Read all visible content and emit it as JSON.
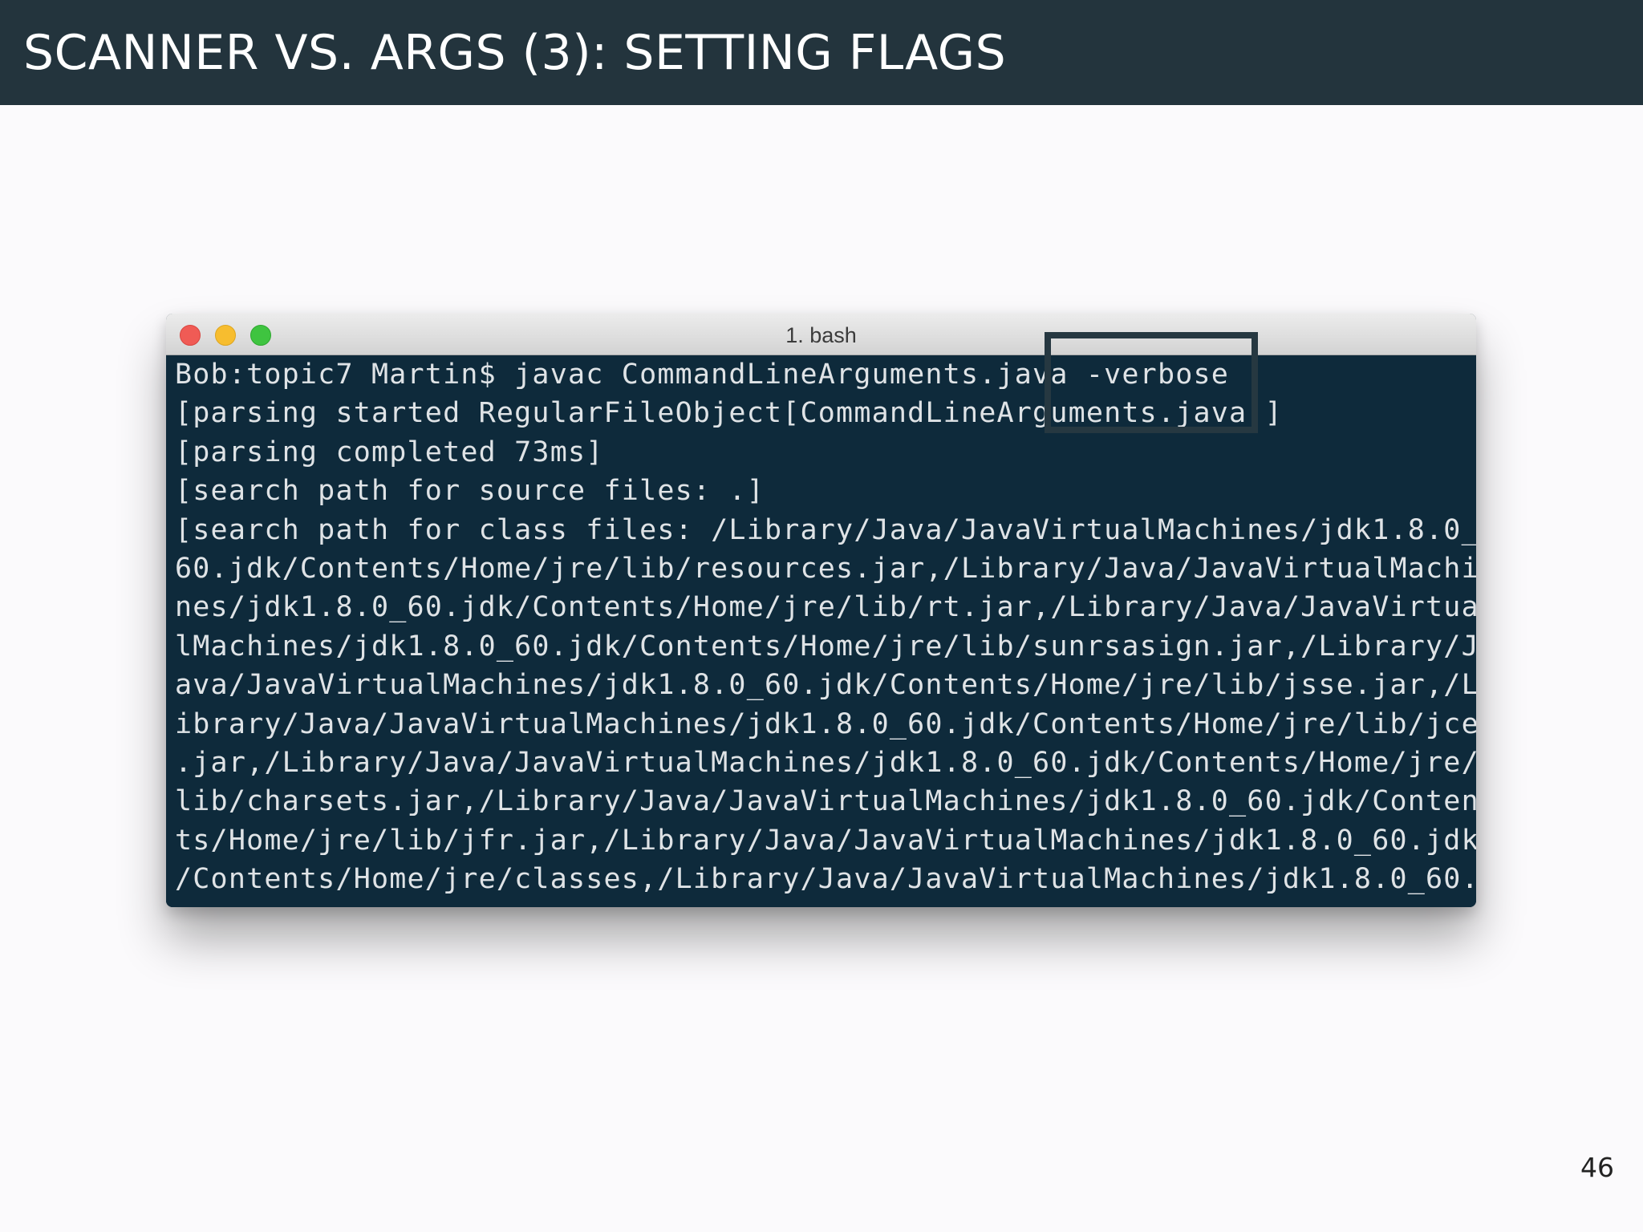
{
  "slide": {
    "title": "SCANNER VS. ARGS (3): SETTING FLAGS",
    "page_number": "46"
  },
  "terminal": {
    "window_title": "1. bash",
    "lines": [
      "Bob:topic7 Martin$ javac CommandLineArguments.java -verbose",
      "[parsing started RegularFileObject[CommandLineArguments.java]]",
      "[parsing completed 73ms]",
      "[search path for source files: .]",
      "[search path for class files: /Library/Java/JavaVirtualMachines/jdk1.8.0_",
      "60.jdk/Contents/Home/jre/lib/resources.jar,/Library/Java/JavaVirtualMachi",
      "nes/jdk1.8.0_60.jdk/Contents/Home/jre/lib/rt.jar,/Library/Java/JavaVirtua",
      "lMachines/jdk1.8.0_60.jdk/Contents/Home/jre/lib/sunrsasign.jar,/Library/J",
      "ava/JavaVirtualMachines/jdk1.8.0_60.jdk/Contents/Home/jre/lib/jsse.jar,/L",
      "ibrary/Java/JavaVirtualMachines/jdk1.8.0_60.jdk/Contents/Home/jre/lib/jce",
      ".jar,/Library/Java/JavaVirtualMachines/jdk1.8.0_60.jdk/Contents/Home/jre/",
      "lib/charsets.jar,/Library/Java/JavaVirtualMachines/jdk1.8.0_60.jdk/Conten",
      "ts/Home/jre/lib/jfr.jar,/Library/Java/JavaVirtualMachines/jdk1.8.0_60.jdk",
      "/Contents/Home/jre/classes,/Library/Java/JavaVirtualMachines/jdk1.8.0_60."
    ]
  },
  "colors": {
    "header_background": "#23343d",
    "slide_background": "#fbfafc",
    "terminal_background": "#0e2a3b",
    "terminal_text": "#dfe3e6",
    "highlight_border": "#263841",
    "close_button": "#f05b55",
    "minimize_button": "#f7bd2f",
    "zoom_button": "#3fc440"
  },
  "icons": {
    "close": "close-icon",
    "minimize": "minimize-icon",
    "zoom": "zoom-icon"
  }
}
